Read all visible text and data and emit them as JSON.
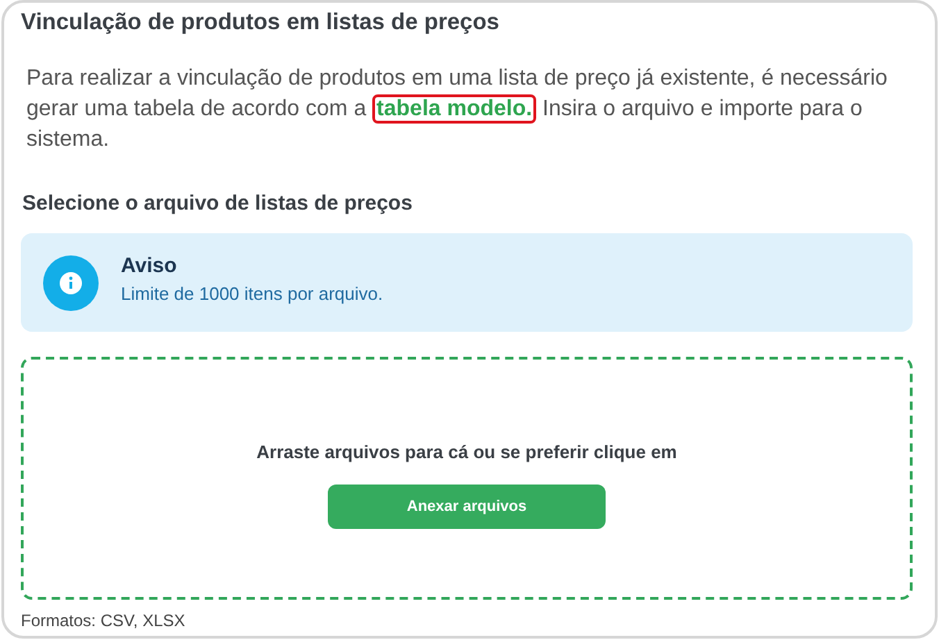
{
  "title": "Vinculação de produtos em listas de preços",
  "intro": {
    "before": "Para realizar a vinculação de produtos em uma lista de preço já existente, é necessário gerar uma tabela de acordo com a",
    "link": "tabela modelo.",
    "after": "Insira o arquivo e importe para o sistema."
  },
  "section_title": "Selecione o arquivo de listas de preços",
  "notice": {
    "title": "Aviso",
    "message": "Limite de 1000 itens por arquivo."
  },
  "dropzone": {
    "prompt": "Arraste arquivos para cá ou se preferir clique em",
    "button": "Anexar arquivos"
  },
  "formats": "Formatos: CSV, XLSX"
}
